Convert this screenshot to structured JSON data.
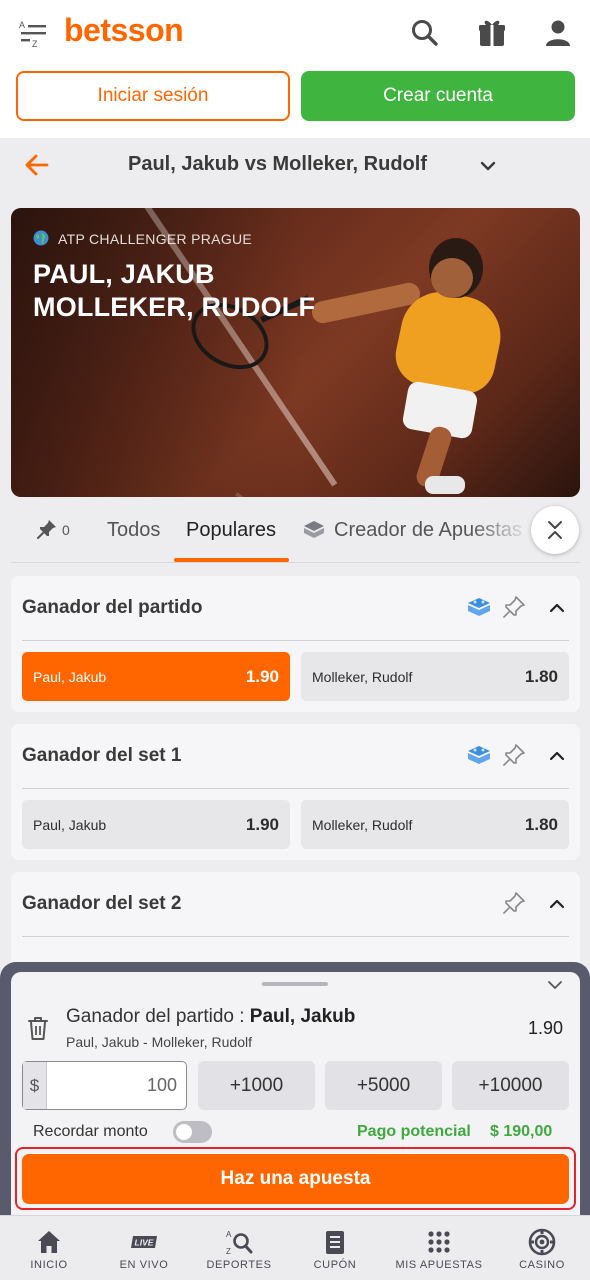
{
  "header": {
    "logo": "betsson",
    "login_label": "Iniciar sesión",
    "register_label": "Crear cuenta"
  },
  "match": {
    "title": "Paul, Jakub vs Molleker, Rudolf"
  },
  "hero": {
    "tournament": "ATP CHALLENGER PRAGUE",
    "player1": "PAUL, JAKUB",
    "player2": "MOLLEKER, RUDOLF"
  },
  "tabs": {
    "pinned_count": "0",
    "items": [
      "Todos",
      "Populares",
      "Creador de Apuestas"
    ],
    "active": "Populares"
  },
  "markets": [
    {
      "title": "Ganador del partido",
      "outcomes": [
        {
          "name": "Paul, Jakub",
          "odd": "1.90",
          "selected": true
        },
        {
          "name": "Molleker, Rudolf",
          "odd": "1.80",
          "selected": false
        }
      ]
    },
    {
      "title": "Ganador del set 1",
      "outcomes": [
        {
          "name": "Paul, Jakub",
          "odd": "1.90",
          "selected": false
        },
        {
          "name": "Molleker, Rudolf",
          "odd": "1.80",
          "selected": false
        }
      ]
    },
    {
      "title": "Ganador del set 2",
      "outcomes": []
    }
  ],
  "betslip": {
    "market_label": "Ganador del partido : ",
    "selection": "Paul, Jakub",
    "match": "Paul, Jakub - Molleker, Rudolf",
    "odd": "1.90",
    "currency": "$",
    "stake": "100",
    "quick_stakes": [
      "+1000",
      "+5000",
      "+10000"
    ],
    "remember_label": "Recordar monto",
    "remember_enabled": false,
    "payout_label": "Pago potencial",
    "payout_value": "$ 190,00",
    "place_label": "Haz una apuesta"
  },
  "bottom_nav": [
    {
      "label": "INICIO",
      "icon": "home-icon"
    },
    {
      "label": "EN VIVO",
      "icon": "live-icon"
    },
    {
      "label": "DEPORTES",
      "icon": "sports-search-icon"
    },
    {
      "label": "CUPÓN",
      "icon": "coupon-icon"
    },
    {
      "label": "MIS APUESTAS",
      "icon": "grid-icon"
    },
    {
      "label": "CASINO",
      "icon": "casino-chip-icon"
    }
  ],
  "live_badge": "LIVE",
  "colors": {
    "brand": "#ff6600",
    "register": "#3fb540",
    "payout": "#3fa93f",
    "highlight": "#e3242b"
  }
}
